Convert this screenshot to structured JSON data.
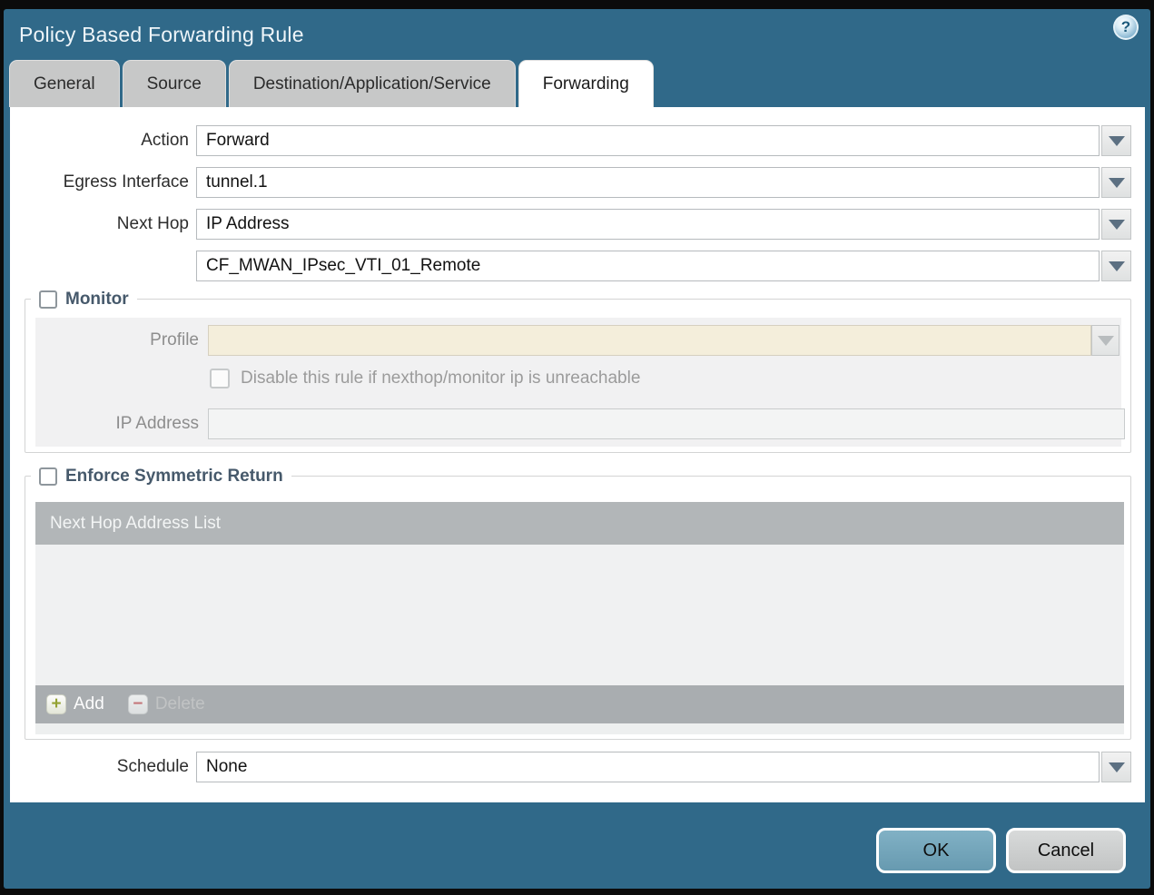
{
  "dialog": {
    "title": "Policy Based Forwarding Rule",
    "help_glyph": "?",
    "tabs": [
      {
        "label": "General",
        "active": false
      },
      {
        "label": "Source",
        "active": false
      },
      {
        "label": "Destination/Application/Service",
        "active": false
      },
      {
        "label": "Forwarding",
        "active": true
      }
    ]
  },
  "form": {
    "action": {
      "label": "Action",
      "value": "Forward"
    },
    "egress_interface": {
      "label": "Egress Interface",
      "value": "tunnel.1"
    },
    "next_hop": {
      "label": "Next Hop",
      "value": "IP Address"
    },
    "next_hop_address": {
      "value": "CF_MWAN_IPsec_VTI_01_Remote"
    },
    "schedule": {
      "label": "Schedule",
      "value": "None"
    }
  },
  "monitor": {
    "legend": "Monitor",
    "checked": false,
    "profile": {
      "label": "Profile",
      "value": ""
    },
    "disable_rule": {
      "label": "Disable this rule if nexthop/monitor ip is unreachable",
      "checked": false
    },
    "ip_address": {
      "label": "IP Address",
      "value": ""
    }
  },
  "symmetric_return": {
    "legend": "Enforce Symmetric Return",
    "checked": false,
    "table": {
      "header": "Next Hop Address List",
      "rows": []
    },
    "add_label": "Add",
    "delete_label": "Delete",
    "add_icon_glyph": "+",
    "delete_icon_glyph": "−"
  },
  "footer": {
    "ok_label": "OK",
    "cancel_label": "Cancel"
  },
  "colors": {
    "titlebar": "#306989",
    "active_tab": "#ffffff",
    "inactive_tab": "#c7c8c8",
    "disabled_field_cream": "#f4eedb",
    "table_header": "#b2b6b8",
    "ok_button": "#74a7bc",
    "cancel_button": "#c9cbcb"
  }
}
